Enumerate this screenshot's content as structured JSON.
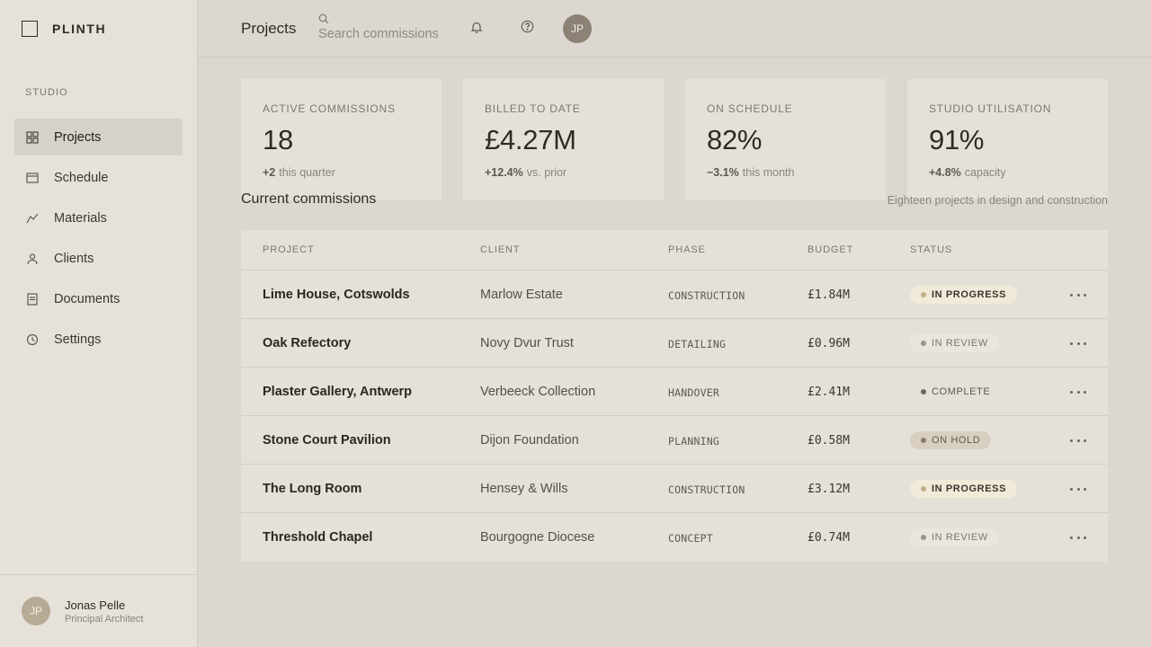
{
  "brand": {
    "name": "PLINTH"
  },
  "sidebar": {
    "section_label": "STUDIO",
    "items": [
      {
        "label": "Projects",
        "icon": "grid-icon",
        "active": true
      },
      {
        "label": "Schedule",
        "icon": "calendar-icon",
        "active": false
      },
      {
        "label": "Materials",
        "icon": "trend-icon",
        "active": false
      },
      {
        "label": "Clients",
        "icon": "user-icon",
        "active": false
      },
      {
        "label": "Documents",
        "icon": "document-icon",
        "active": false
      },
      {
        "label": "Settings",
        "icon": "clock-icon",
        "active": false
      }
    ],
    "user": {
      "initials": "JP",
      "name": "Jonas Pelle",
      "role": "Principal Architect"
    }
  },
  "header": {
    "title": "Projects",
    "search_placeholder": "Search commissions",
    "avatar_initials": "JP"
  },
  "stats": [
    {
      "label": "ACTIVE COMMISSIONS",
      "value": "18",
      "delta": "+2",
      "note": "this quarter"
    },
    {
      "label": "BILLED TO DATE",
      "value": "£4.27M",
      "delta": "+12.4%",
      "note": "vs. prior"
    },
    {
      "label": "ON SCHEDULE",
      "value": "82%",
      "delta": "−3.1%",
      "note": "this month"
    },
    {
      "label": "STUDIO UTILISATION",
      "value": "91%",
      "delta": "+4.8%",
      "note": "capacity"
    }
  ],
  "commissions": {
    "title": "Current commissions",
    "subtitle": "Eighteen projects in design and construction",
    "columns": {
      "project": "PROJECT",
      "client": "CLIENT",
      "phase": "PHASE",
      "budget": "BUDGET",
      "status": "STATUS"
    },
    "rows": [
      {
        "project": "Lime House, Cotswolds",
        "client": "Marlow Estate",
        "phase": "CONSTRUCTION",
        "budget": "£1.84M",
        "status": "IN PROGRESS",
        "status_kind": "progress"
      },
      {
        "project": "Oak Refectory",
        "client": "Novy Dvur Trust",
        "phase": "DETAILING",
        "budget": "£0.96M",
        "status": "IN REVIEW",
        "status_kind": "review"
      },
      {
        "project": "Plaster Gallery, Antwerp",
        "client": "Verbeeck Collection",
        "phase": "HANDOVER",
        "budget": "£2.41M",
        "status": "COMPLETE",
        "status_kind": "complete"
      },
      {
        "project": "Stone Court Pavilion",
        "client": "Dijon Foundation",
        "phase": "PLANNING",
        "budget": "£0.58M",
        "status": "ON HOLD",
        "status_kind": "hold"
      },
      {
        "project": "The Long Room",
        "client": "Hensey & Wills",
        "phase": "CONSTRUCTION",
        "budget": "£3.12M",
        "status": "IN PROGRESS",
        "status_kind": "progress"
      },
      {
        "project": "Threshold Chapel",
        "client": "Bourgogne Diocese",
        "phase": "CONCEPT",
        "budget": "£0.74M",
        "status": "IN REVIEW",
        "status_kind": "review"
      }
    ]
  }
}
